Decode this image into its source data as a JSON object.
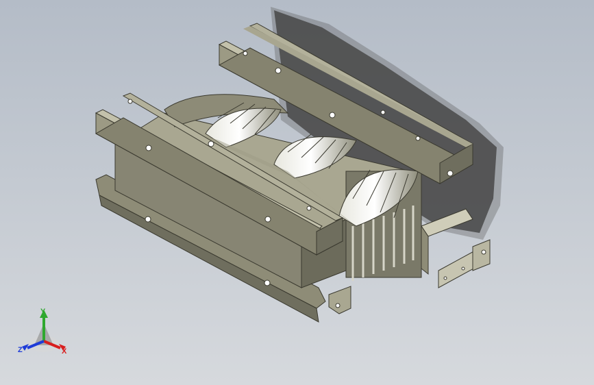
{
  "viewport": {
    "background_top": "#b4bcc7",
    "background_bottom": "#d6d9dd",
    "model_color": "#9c9a84",
    "model_dark": "#6f6e5e",
    "model_light": "#c4c3ad"
  },
  "triad": {
    "x_label": "X",
    "y_label": "Y",
    "z_label": "Z",
    "x_color": "#d81e1e",
    "y_color": "#2fa82f",
    "z_color": "#1e3cd8"
  }
}
